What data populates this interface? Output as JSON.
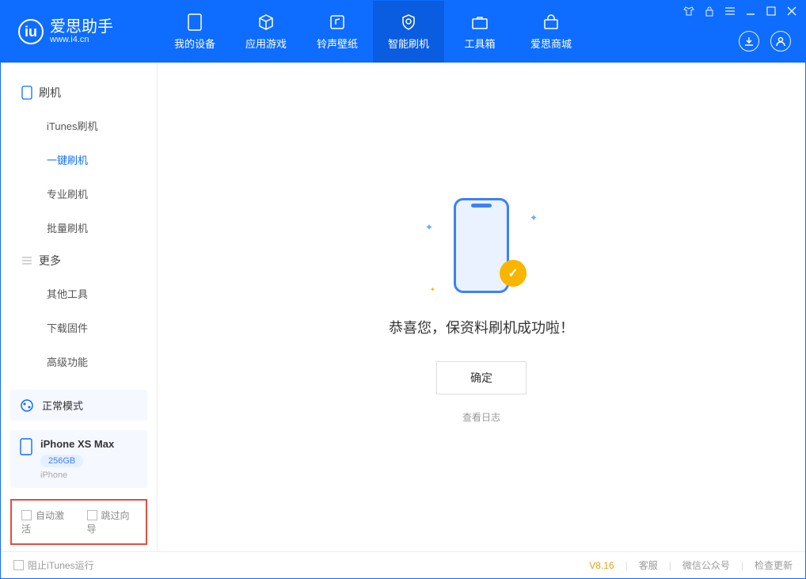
{
  "brand": {
    "name": "爱思助手",
    "url": "www.i4.cn"
  },
  "topTabs": {
    "device": "我的设备",
    "apps": "应用游戏",
    "ring": "铃声壁纸",
    "flash": "智能刷机",
    "tools": "工具箱",
    "store": "爱思商城"
  },
  "sidebar": {
    "group1": {
      "title": "刷机",
      "items": [
        "iTunes刷机",
        "一键刷机",
        "专业刷机",
        "批量刷机"
      ]
    },
    "group2": {
      "title": "更多",
      "items": [
        "其他工具",
        "下载固件",
        "高级功能"
      ]
    }
  },
  "mode": {
    "label": "正常模式"
  },
  "device": {
    "name": "iPhone XS Max",
    "capacity": "256GB",
    "type": "iPhone"
  },
  "checks": {
    "auto": "自动激活",
    "skip": "跳过向导"
  },
  "main": {
    "success": "恭喜您，保资料刷机成功啦！",
    "ok": "确定",
    "log": "查看日志"
  },
  "footer": {
    "blockItunes": "阻止iTunes运行",
    "version": "V8.16",
    "support": "客服",
    "wechat": "微信公众号",
    "update": "检查更新"
  }
}
